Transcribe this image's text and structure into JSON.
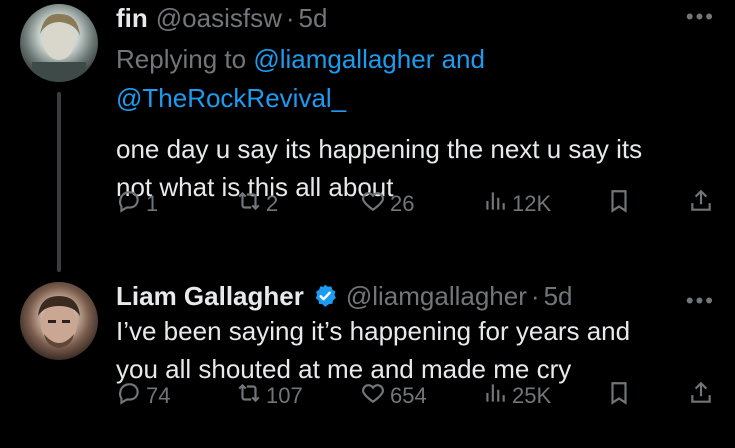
{
  "tweets": [
    {
      "name": "fin",
      "handle": "@oasisfsw",
      "time": "5d",
      "replying_prefix": "Replying to ",
      "replying_to_1": "@liamgallagher",
      "replying_and": " and",
      "replying_to_2": "@TheRockRevival_",
      "text_line1": "one day u say its happening the next u say its",
      "text_line2": "not what is this all about",
      "replies": "1",
      "reposts": "2",
      "likes": "26",
      "views": "12K"
    },
    {
      "name": "Liam Gallagher",
      "verified": true,
      "handle": "@liamgallagher",
      "time": "5d",
      "text_line1": "I’ve been saying it’s happening for years and",
      "text_line2": "you all shouted at me and made me cry",
      "replies": "74",
      "reposts": "107",
      "likes": "654",
      "views": "25K"
    }
  ],
  "ui": {
    "separator": "·",
    "more": "•••"
  },
  "colors": {
    "background": "#000000",
    "text": "#e7e9ea",
    "muted": "#71767b",
    "link": "#1d9bf0",
    "verified": "#1d9bf0"
  },
  "icons": [
    "reply-icon",
    "repost-icon",
    "like-icon",
    "views-icon",
    "bookmark-icon",
    "share-icon",
    "more-icon",
    "verified-badge-icon"
  ]
}
